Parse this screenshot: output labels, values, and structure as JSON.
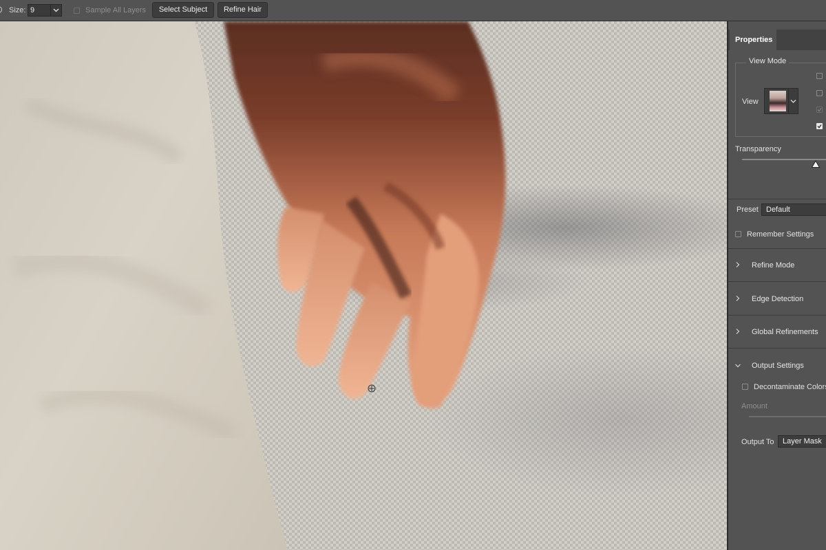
{
  "options_bar": {
    "size_label": "Size:",
    "size_value": "9",
    "sample_all_layers_label": "Sample All Layers",
    "sample_all_layers_checked": false,
    "select_subject_label": "Select Subject",
    "refine_hair_label": "Refine Hair"
  },
  "panel": {
    "tab_label": "Properties",
    "view_mode": {
      "title": "View Mode",
      "view_label": "View",
      "checkboxes": [
        {
          "checked": false,
          "enabled": true
        },
        {
          "checked": false,
          "enabled": true
        },
        {
          "checked": true,
          "enabled": false
        },
        {
          "checked": true,
          "enabled": true
        }
      ]
    },
    "transparency": {
      "label": "Transparency",
      "value": 0.86
    },
    "preset": {
      "label": "Preset",
      "value": "Default"
    },
    "remember_settings": {
      "label": "Remember Settings",
      "checked": false
    },
    "sections": {
      "refine_mode": "Refine Mode",
      "edge_detection": "Edge Detection",
      "global_refinements": "Global Refinements",
      "output_settings": "Output Settings"
    },
    "output": {
      "decontaminate_label": "Decontaminate Colors",
      "decontaminate_checked": false,
      "amount_label": "Amount",
      "output_to_label": "Output To",
      "output_to_value": "Layer Mask"
    }
  },
  "colors": {
    "ui_background": "#535353",
    "canvas_checker_light": "#d2cfc9",
    "canvas_checker_dark": "#bdbab4",
    "skin_tone": "#e0a07c",
    "fabric": "#d8d2c6"
  }
}
